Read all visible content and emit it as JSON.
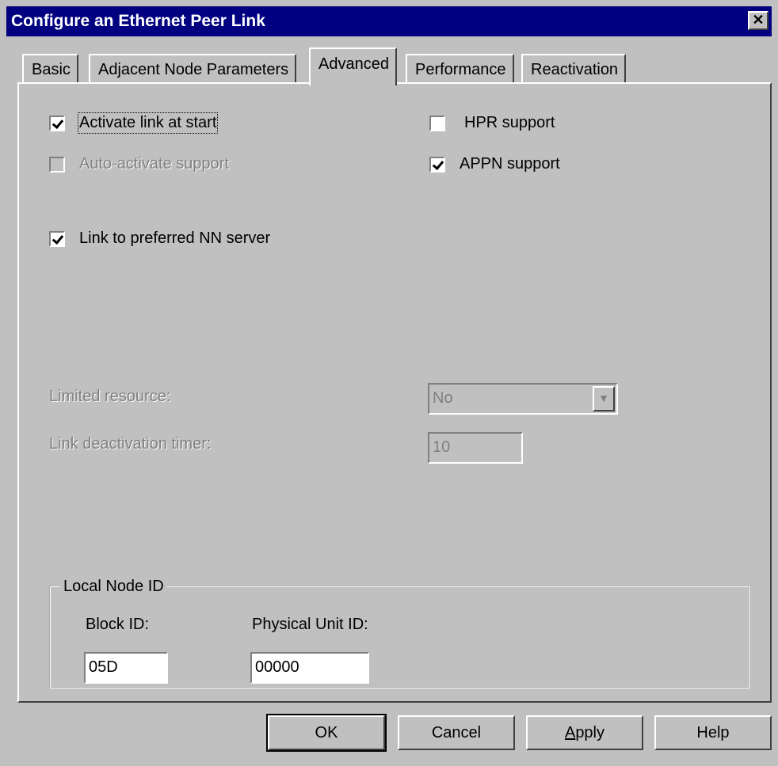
{
  "window": {
    "title": "Configure an Ethernet Peer Link"
  },
  "tabs": [
    {
      "label": "Basic",
      "active": false
    },
    {
      "label": "Adjacent Node Parameters",
      "active": false
    },
    {
      "label": "Advanced",
      "active": true
    },
    {
      "label": "Performance",
      "active": false
    },
    {
      "label": "Reactivation",
      "active": false
    }
  ],
  "checkboxes": {
    "activate_link": {
      "label": "Activate link at start",
      "checked": true,
      "enabled": true
    },
    "auto_activate": {
      "label": "Auto-activate support",
      "checked": false,
      "enabled": false
    },
    "hpr_support": {
      "label": "HPR support",
      "checked": false,
      "enabled": true
    },
    "appn_support": {
      "label": "APPN support",
      "checked": true,
      "enabled": true
    },
    "preferred_nn": {
      "label": "Link to preferred NN server",
      "checked": true,
      "enabled": true
    }
  },
  "limited_resource": {
    "label": "Limited resource:",
    "value": "No"
  },
  "deactivation_timer": {
    "label": "Link deactivation timer:",
    "value": "10"
  },
  "local_node": {
    "title": "Local Node ID",
    "block_id_label": "Block ID:",
    "block_id_value": "05D",
    "pu_id_label": "Physical Unit ID:",
    "pu_id_value": "00000"
  },
  "buttons": {
    "ok": "OK",
    "cancel": "Cancel",
    "apply": "Apply",
    "help": "Help"
  }
}
